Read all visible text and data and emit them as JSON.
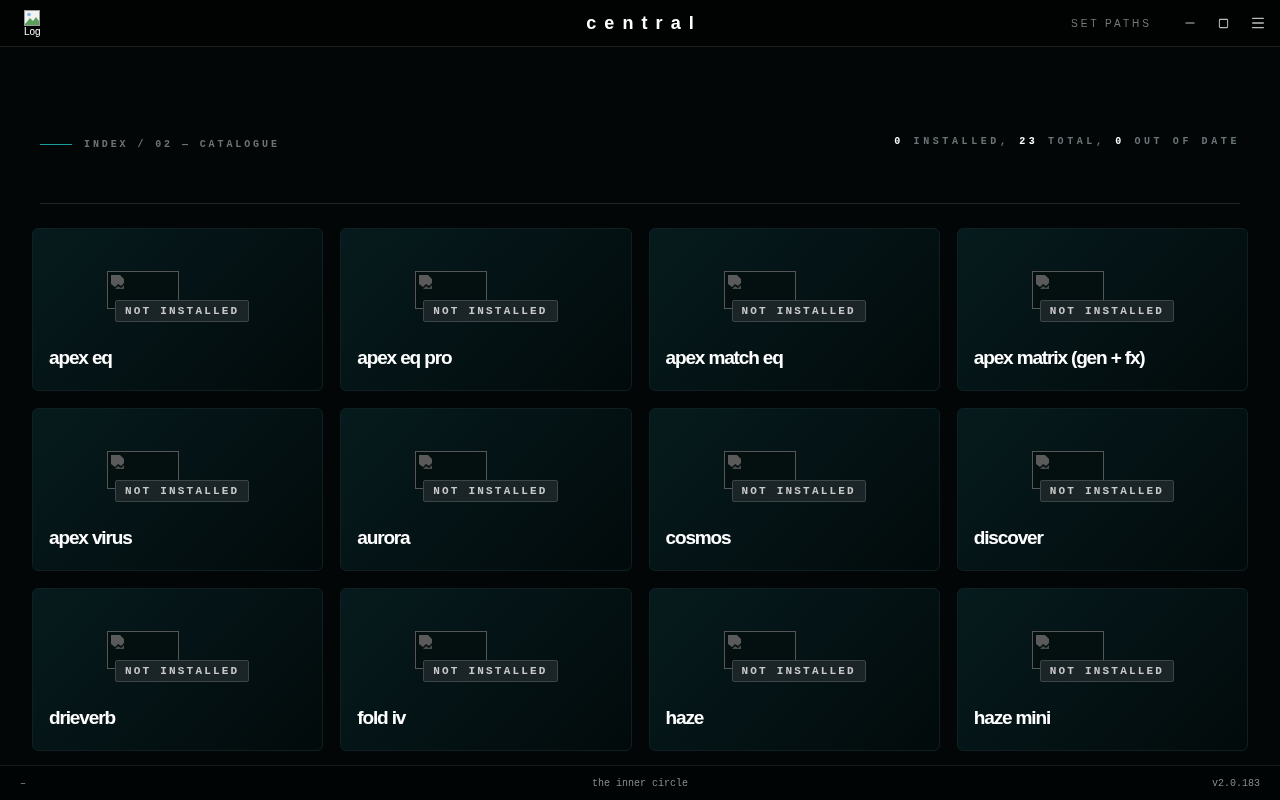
{
  "header": {
    "logo": {
      "alt_text": "Log"
    },
    "title": "central",
    "set_paths": "SET PATHS"
  },
  "section": {
    "breadcrumb": "INDEX / 02 — CATALOGUE",
    "summary": "**0** INSTALLED, **23** TOTAL, **0** OUT OF DATE"
  },
  "plugins": [
    {
      "name": "apex eq",
      "status": "NOT INSTALLED"
    },
    {
      "name": "apex eq pro",
      "status": "NOT INSTALLED"
    },
    {
      "name": "apex match eq",
      "status": "NOT INSTALLED"
    },
    {
      "name": "apex matrix (gen + fx)",
      "status": "NOT INSTALLED"
    },
    {
      "name": "apex virus",
      "status": "NOT INSTALLED"
    },
    {
      "name": "aurora",
      "status": "NOT INSTALLED"
    },
    {
      "name": "cosmos",
      "status": "NOT INSTALLED"
    },
    {
      "name": "discover",
      "status": "NOT INSTALLED"
    },
    {
      "name": "drieverb",
      "status": "NOT INSTALLED"
    },
    {
      "name": "fold iv",
      "status": "NOT INSTALLED"
    },
    {
      "name": "haze",
      "status": "NOT INSTALLED"
    },
    {
      "name": "haze mini",
      "status": "NOT INSTALLED"
    }
  ],
  "footer": {
    "left": "–",
    "center": "the inner circle",
    "version": "v2.0.183"
  }
}
